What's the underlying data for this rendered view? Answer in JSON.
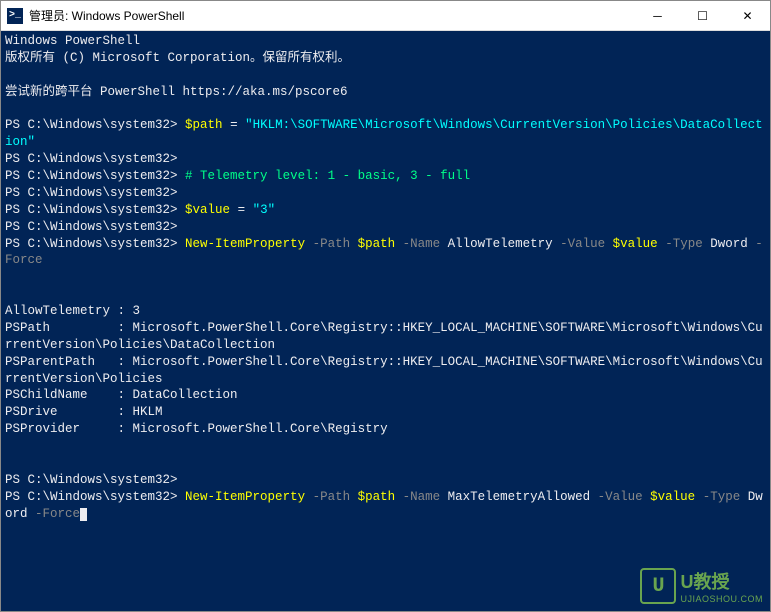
{
  "titlebar": {
    "icon_glyph": ">_",
    "title": "管理员: Windows PowerShell"
  },
  "banner": {
    "line1": "Windows PowerShell",
    "line2": "版权所有 (C) Microsoft Corporation。保留所有权利。",
    "line3": "尝试新的跨平台 PowerShell https://aka.ms/pscore6"
  },
  "prompt": "PS C:\\Windows\\system32>",
  "cmd1": {
    "var": "$path",
    "eq": " = ",
    "val": "\"HKLM:\\SOFTWARE\\Microsoft\\Windows\\CurrentVersion\\Policies\\DataCollection\""
  },
  "cmd2": {
    "comment": "# Telemetry level: 1 - basic, 3 - full"
  },
  "cmd3": {
    "var": "$value",
    "eq": " = ",
    "val": "\"3\""
  },
  "cmd4": {
    "cmdlet": "New-ItemProperty",
    "p_path": " -Path ",
    "v_path": "$path",
    "p_name": " -Name ",
    "v_name": "AllowTelemetry",
    "p_value": " -Value ",
    "v_value": "$value",
    "p_type": " -Type ",
    "v_type": "Dword",
    "p_force": " -Force"
  },
  "output": {
    "r1k": "AllowTelemetry :",
    "r1v": " 3",
    "r2k": "PSPath         :",
    "r2v": " Microsoft.PowerShell.Core\\Registry::HKEY_LOCAL_MACHINE\\SOFTWARE\\Microsoft\\Windows\\CurrentVersion\\Policies\\DataCollection",
    "r3k": "PSParentPath   :",
    "r3v": " Microsoft.PowerShell.Core\\Registry::HKEY_LOCAL_MACHINE\\SOFTWARE\\Microsoft\\Windows\\CurrentVersion\\Policies",
    "r4k": "PSChildName    :",
    "r4v": " DataCollection",
    "r5k": "PSDrive        :",
    "r5v": " HKLM",
    "r6k": "PSProvider     :",
    "r6v": " Microsoft.PowerShell.Core\\Registry"
  },
  "cmd5": {
    "cmdlet": "New-ItemProperty",
    "p_path": " -Path ",
    "v_path": "$path",
    "p_name": " -Name ",
    "v_name": "MaxTelemetryAllowed",
    "p_value": " -Value ",
    "v_value": "$value",
    "p_type": " -Type ",
    "v_type": "Dword",
    "p_force": " -Force"
  },
  "watermark": {
    "icon": "U",
    "name": "U教授",
    "url": "UJIAOSHOU.COM"
  }
}
